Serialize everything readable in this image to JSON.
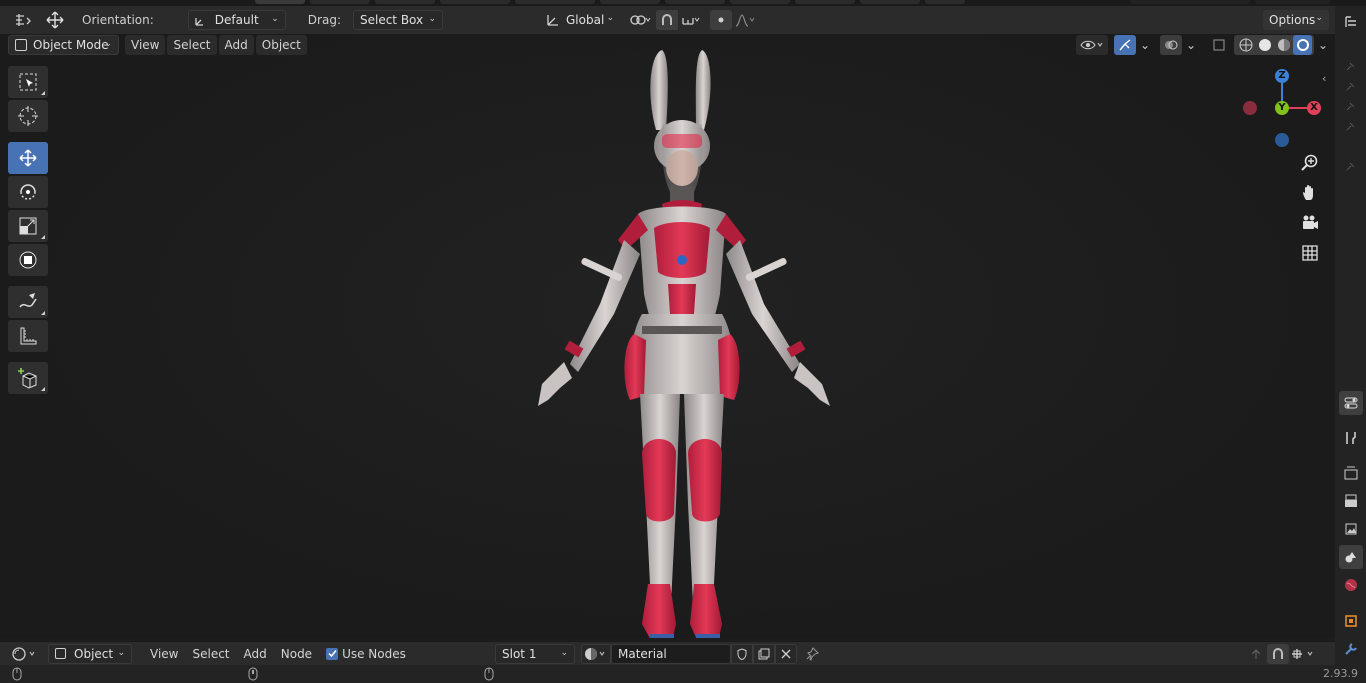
{
  "header": {
    "orientation_label": "Orientation:",
    "orientation_value": "Default",
    "drag_label": "Drag:",
    "drag_value": "Select Box",
    "transform_space": "Global",
    "options_label": "Options"
  },
  "viewport_header": {
    "mode": "Object Mode",
    "menus": [
      "View",
      "Select",
      "Add",
      "Object"
    ]
  },
  "gizmo": {
    "x": "X",
    "y": "Y",
    "z": "Z"
  },
  "node_editor": {
    "mode": "Object",
    "menus": [
      "View",
      "Select",
      "Add",
      "Node"
    ],
    "use_nodes_label": "Use Nodes",
    "use_nodes_checked": true,
    "slot": "Slot 1",
    "material": "Material"
  },
  "status": {
    "version": "2.93.9"
  },
  "colors": {
    "accent": "#4772b3",
    "axis_x": "#e0415a",
    "axis_y": "#83c21c",
    "axis_z": "#3b82d6"
  }
}
